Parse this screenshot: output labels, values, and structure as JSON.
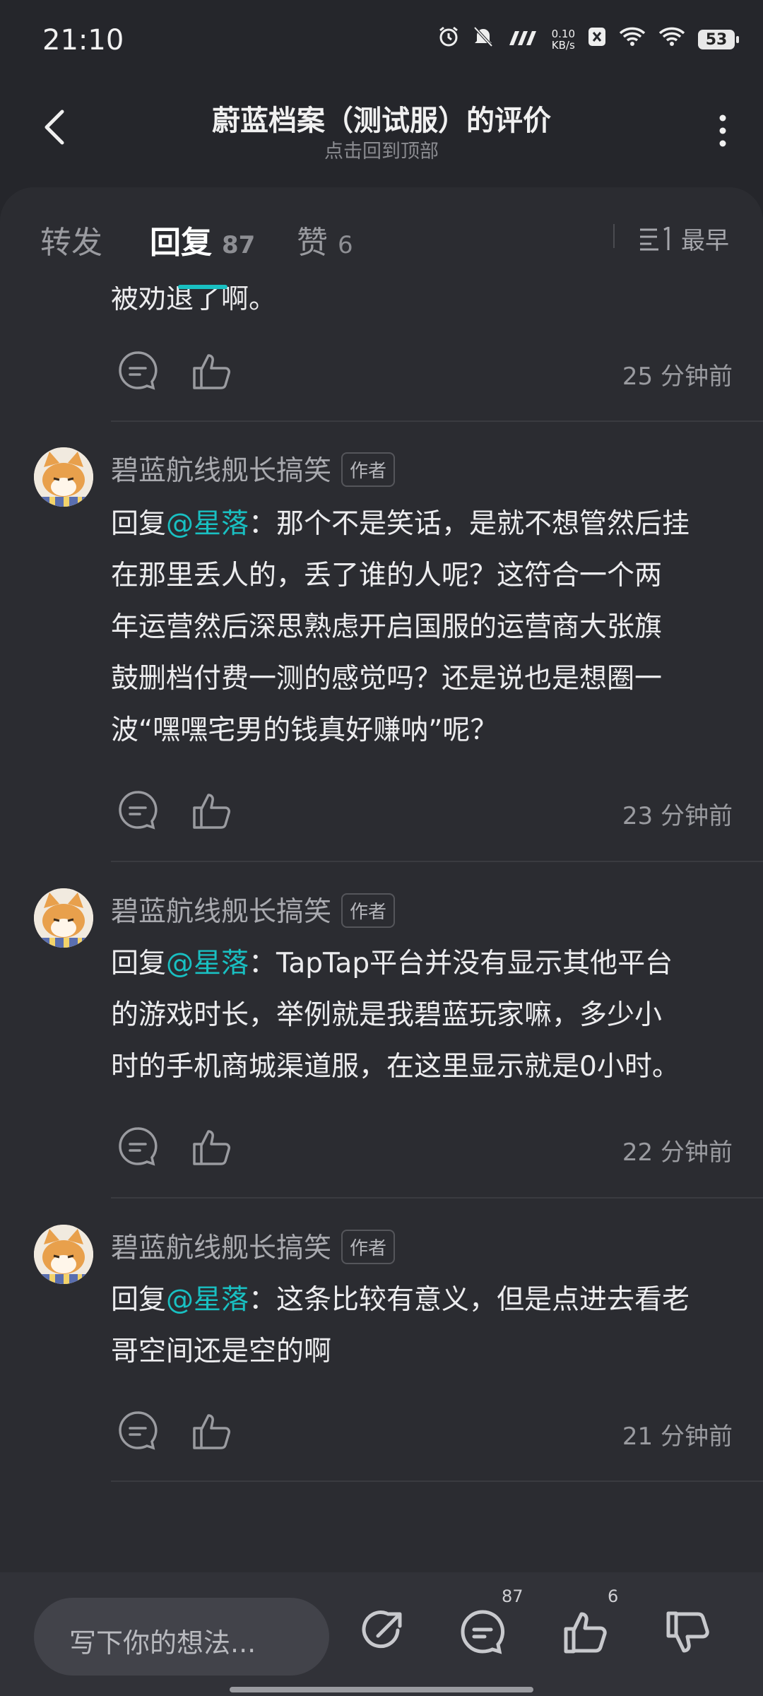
{
  "status_bar": {
    "time": "21:10",
    "net_speed_value": "0.10",
    "net_speed_unit": "KB/s",
    "battery": "53"
  },
  "header": {
    "title": "蔚蓝档案（测试服）的评价",
    "subtitle": "点击回到顶部"
  },
  "tabs": [
    {
      "label": "转发",
      "count": ""
    },
    {
      "label": "回复",
      "count": "87"
    },
    {
      "label": "赞",
      "count": "6"
    }
  ],
  "sort_label": "最早",
  "partial_reply": {
    "text": "被劝退了啊。",
    "time": "25 分钟前"
  },
  "replies": [
    {
      "username": "碧蓝航线舰长搞笑",
      "badge": "作者",
      "prefix": "回复",
      "mention": "@星落",
      "lines": [
        "：那个不是笑话，是就不想管然后挂",
        "在那里丢人的，丢了谁的人呢？这符合一个两",
        "年运营然后深思熟虑开启国服的运营商大张旗",
        "鼓删档付费一测的感觉吗？还是说也是想圈一",
        "波“嘿嘿宅男的钱真好赚呐”呢？"
      ],
      "time": "23 分钟前"
    },
    {
      "username": "碧蓝航线舰长搞笑",
      "badge": "作者",
      "prefix": "回复",
      "mention": "@星落",
      "lines": [
        "：TapTap平台并没有显示其他平台",
        "的游戏时长，举例就是我碧蓝玩家嘛，多少小",
        "时的手机商城渠道服，在这里显示就是0小时。"
      ],
      "time": "22 分钟前"
    },
    {
      "username": "碧蓝航线舰长搞笑",
      "badge": "作者",
      "prefix": "回复",
      "mention": "@星落",
      "lines": [
        "：这条比较有意义，但是点进去看老",
        "哥空间还是空的啊"
      ],
      "time": "21 分钟前"
    }
  ],
  "bottom_bar": {
    "input_placeholder": "写下你的想法...",
    "comment_count": "87",
    "like_count": "6"
  },
  "colors": {
    "accent": "#19c0c2",
    "background": "#25262b",
    "card": "#2b2c31"
  },
  "icons": [
    "back-arrow-icon",
    "more-icon",
    "comment-icon",
    "like-icon",
    "sort-icon",
    "share-icon",
    "dislike-icon",
    "alarm-icon",
    "mute-icon",
    "wifi-icon",
    "battery-icon"
  ]
}
